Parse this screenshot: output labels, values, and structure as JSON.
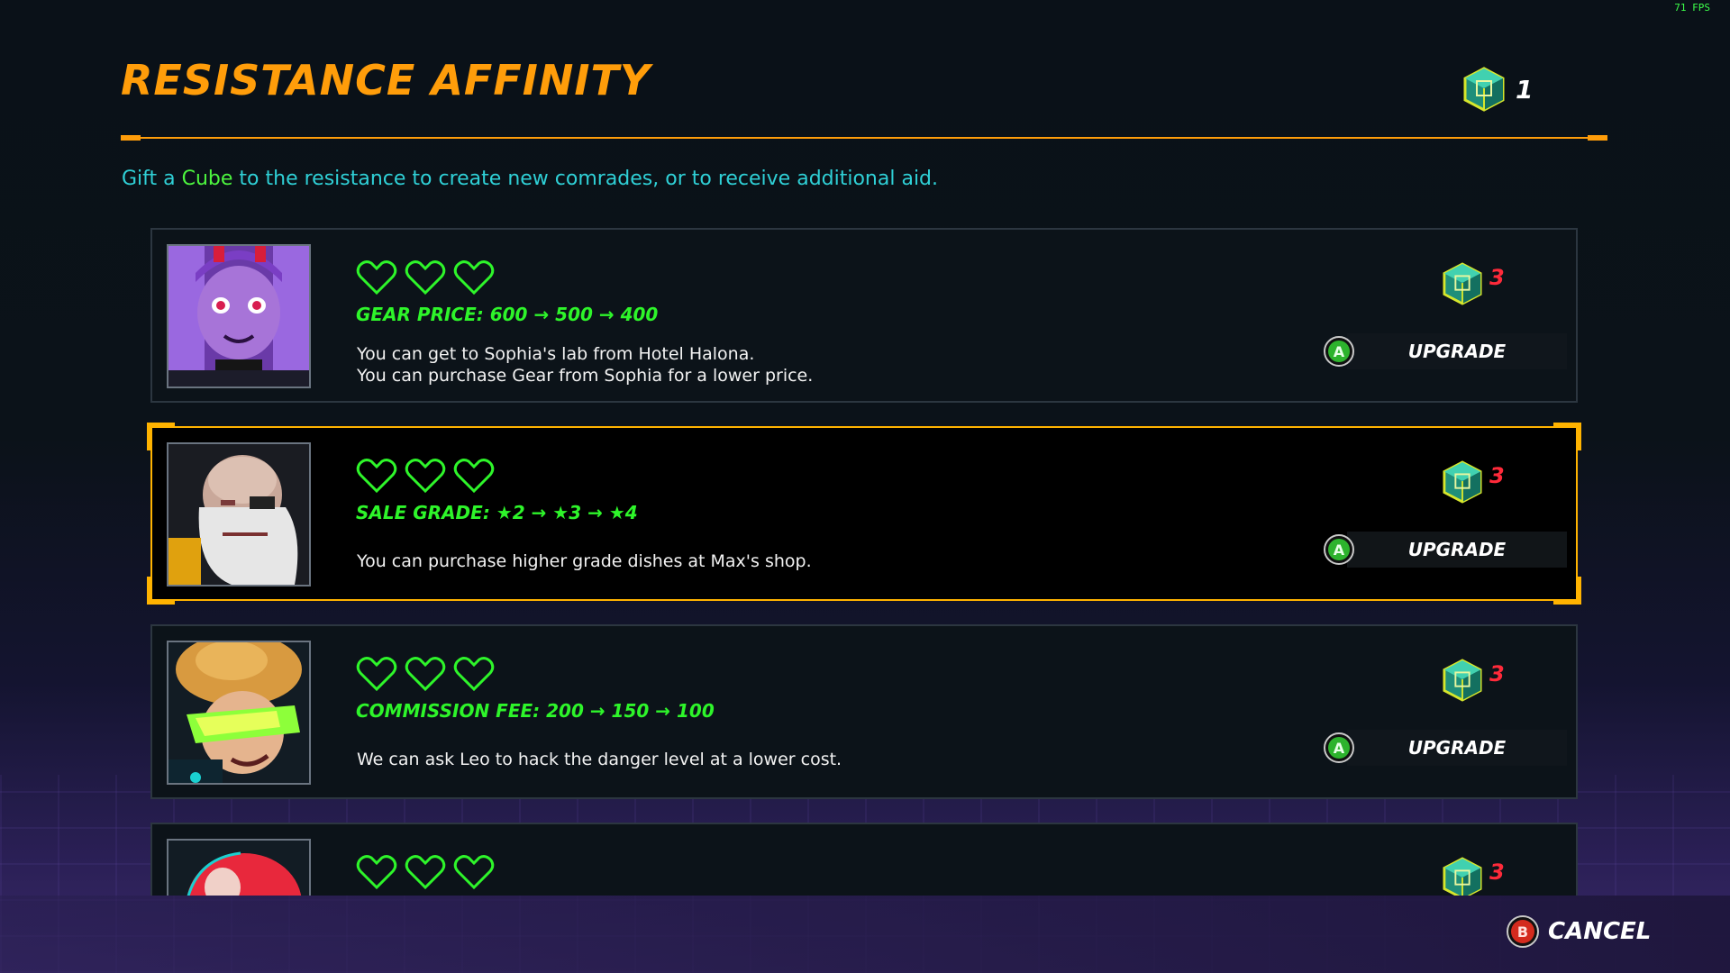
{
  "fps": "71 FPS",
  "title": "RESISTANCE AFFINITY",
  "cube_count": "1",
  "subtitle": {
    "prefix": "Gift a ",
    "highlight": "Cube",
    "suffix": " to the resistance to create new comrades, or to receive additional aid."
  },
  "cards": [
    {
      "name": "Sophia",
      "hearts_total": 3,
      "hearts_filled": 0,
      "stat_label": "GEAR PRICE",
      "stat_values": ": 600 → 500 → 400",
      "desc_line1": "You can get to Sophia's lab from Hotel Halona.",
      "desc_line2": "You can purchase Gear from Sophia for a lower price.",
      "cost": "3",
      "button_glyph": "A",
      "button_label": "UPGRADE"
    },
    {
      "name": "Max",
      "hearts_total": 3,
      "hearts_filled": 0,
      "stat_label": "SALE GRADE",
      "stat_values": ": ★2 → ★3 → ★4",
      "desc_line1": "You can purchase higher grade dishes at Max's shop.",
      "desc_line2": "",
      "cost": "3",
      "button_glyph": "A",
      "button_label": "UPGRADE"
    },
    {
      "name": "Leo",
      "hearts_total": 3,
      "hearts_filled": 0,
      "stat_label": "COMMISSION FEE",
      "stat_values": ": 200 → 150 → 100",
      "desc_line1": "We can ask Leo to hack the danger level at a lower cost.",
      "desc_line2": "",
      "cost": "3",
      "button_glyph": "A",
      "button_label": "UPGRADE"
    },
    {
      "name": "",
      "hearts_total": 3,
      "hearts_filled": 0,
      "cost": "3"
    }
  ],
  "cancel": {
    "glyph": "B",
    "label": "CANCEL"
  },
  "colors": {
    "accent_orange": "#ff9d0a",
    "heart_green": "#2ef52a",
    "cost_red": "#ff2a3a",
    "subtitle_cyan": "#2fd0d6"
  }
}
